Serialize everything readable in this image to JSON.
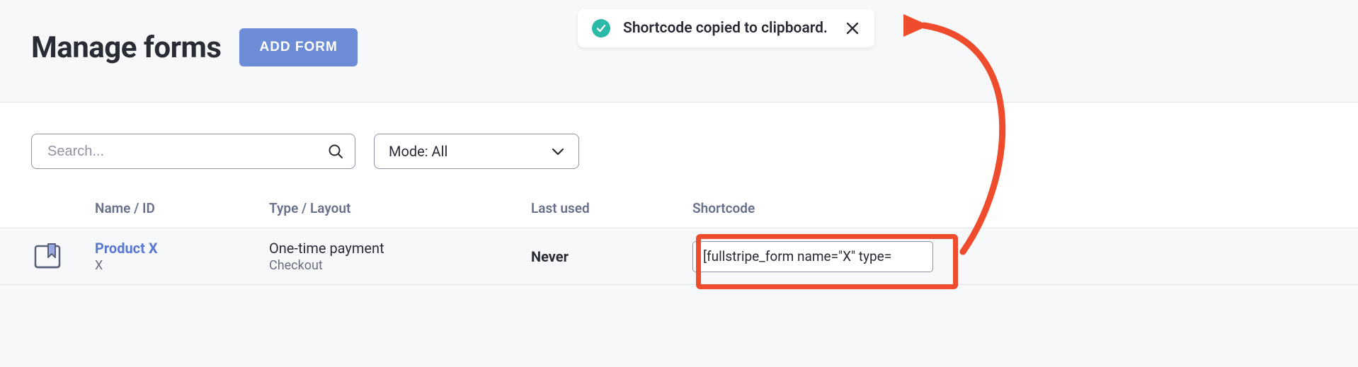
{
  "header": {
    "title": "Manage forms",
    "add_button": "ADD FORM"
  },
  "toast": {
    "message": "Shortcode copied to clipboard."
  },
  "filters": {
    "search_placeholder": "Search...",
    "mode_label": "Mode: All"
  },
  "table": {
    "headers": {
      "name": "Name / ID",
      "type": "Type / Layout",
      "last_used": "Last used",
      "shortcode": "Shortcode"
    },
    "rows": [
      {
        "name": "Product X",
        "id": "X",
        "type": "One-time payment",
        "layout": "Checkout",
        "last_used": "Never",
        "shortcode": "[fullstripe_form name=\"X\" type="
      }
    ]
  }
}
